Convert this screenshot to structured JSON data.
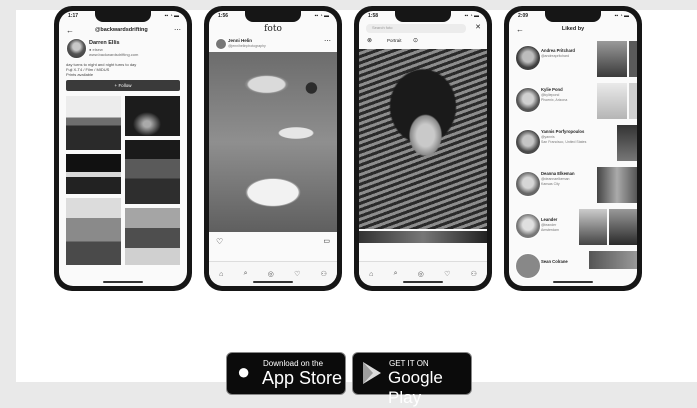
{
  "phone1": {
    "status_time": "1:17",
    "handle": "@backwardsdrifting",
    "name": "Darren Ellis",
    "bio_l1": "● elsew",
    "bio_l2": "www.backwardsdrifting.com",
    "bio_l3": "day turns to night and night turns to day",
    "bio_l4": "Fuji X-T4 / Film / MIDUS",
    "bio_l5": "Prints available",
    "follow_label": "Follow"
  },
  "phone2": {
    "status_time": "1:56",
    "app_title": "foto",
    "user_name": "Jenni Helin",
    "user_sub": "@jennihelinphotography"
  },
  "phone3": {
    "status_time": "1:58",
    "search_placeholder": "Search foto",
    "tab_label": "Portrait"
  },
  "phone4": {
    "status_time": "2:09",
    "title": "Liked by",
    "users": [
      {
        "name": "Andrea Pritchard",
        "handle": "@andreapritchard"
      },
      {
        "name": "Kylie Pond",
        "handle": "@kyliepond",
        "location": "Phoenix, Arizona"
      },
      {
        "name": "Yannis Porfyropoulos",
        "handle": "@yannis",
        "location": "San Francisco, United States"
      },
      {
        "name": "Deanna Elkeman",
        "handle": "@deannaelkeman",
        "location": "Kansas City"
      },
      {
        "name": "Leander",
        "handle": "@leander",
        "location": "Amsterdam"
      },
      {
        "name": "Sean Colrane"
      }
    ]
  },
  "badges": {
    "apple_small": "Download on the",
    "apple_big": "App Store",
    "google_small": "GET IT ON",
    "google_big": "Google Play"
  }
}
